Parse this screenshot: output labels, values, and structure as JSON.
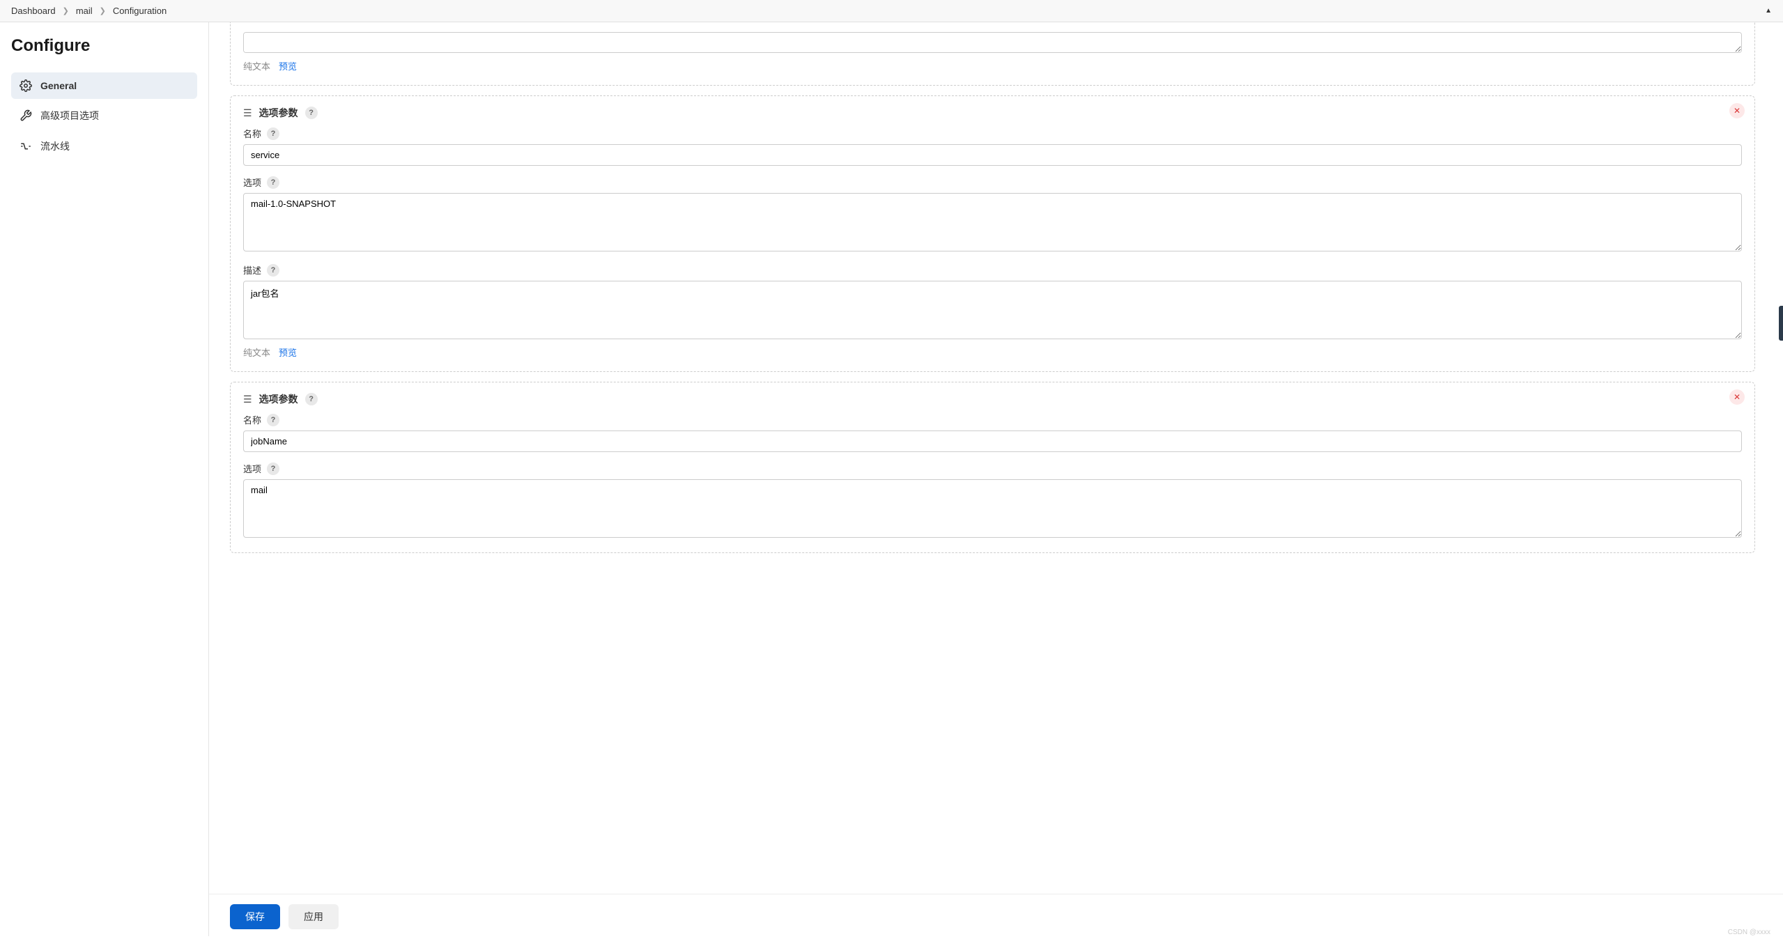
{
  "breadcrumb": {
    "items": [
      "Dashboard",
      "mail",
      "Configuration"
    ]
  },
  "sidebar": {
    "title": "Configure",
    "items": [
      {
        "label": "General"
      },
      {
        "label": "高级项目选项"
      },
      {
        "label": "流水线"
      }
    ]
  },
  "blocks": {
    "partial": {
      "desc_value": "",
      "plain_text": "纯文本",
      "preview": "预览"
    },
    "b1": {
      "title": "选项参数",
      "name_label": "名称",
      "name_value": "service",
      "options_label": "选项",
      "options_value": "mail-1.0-SNAPSHOT",
      "desc_label": "描述",
      "desc_value": "jar包名",
      "plain_text": "纯文本",
      "preview": "预览"
    },
    "b2": {
      "title": "选项参数",
      "name_label": "名称",
      "name_value": "jobName",
      "options_label": "选项",
      "options_value": "mail"
    }
  },
  "buttons": {
    "save": "保存",
    "apply": "应用"
  },
  "watermark": "CSDN @xxxx"
}
